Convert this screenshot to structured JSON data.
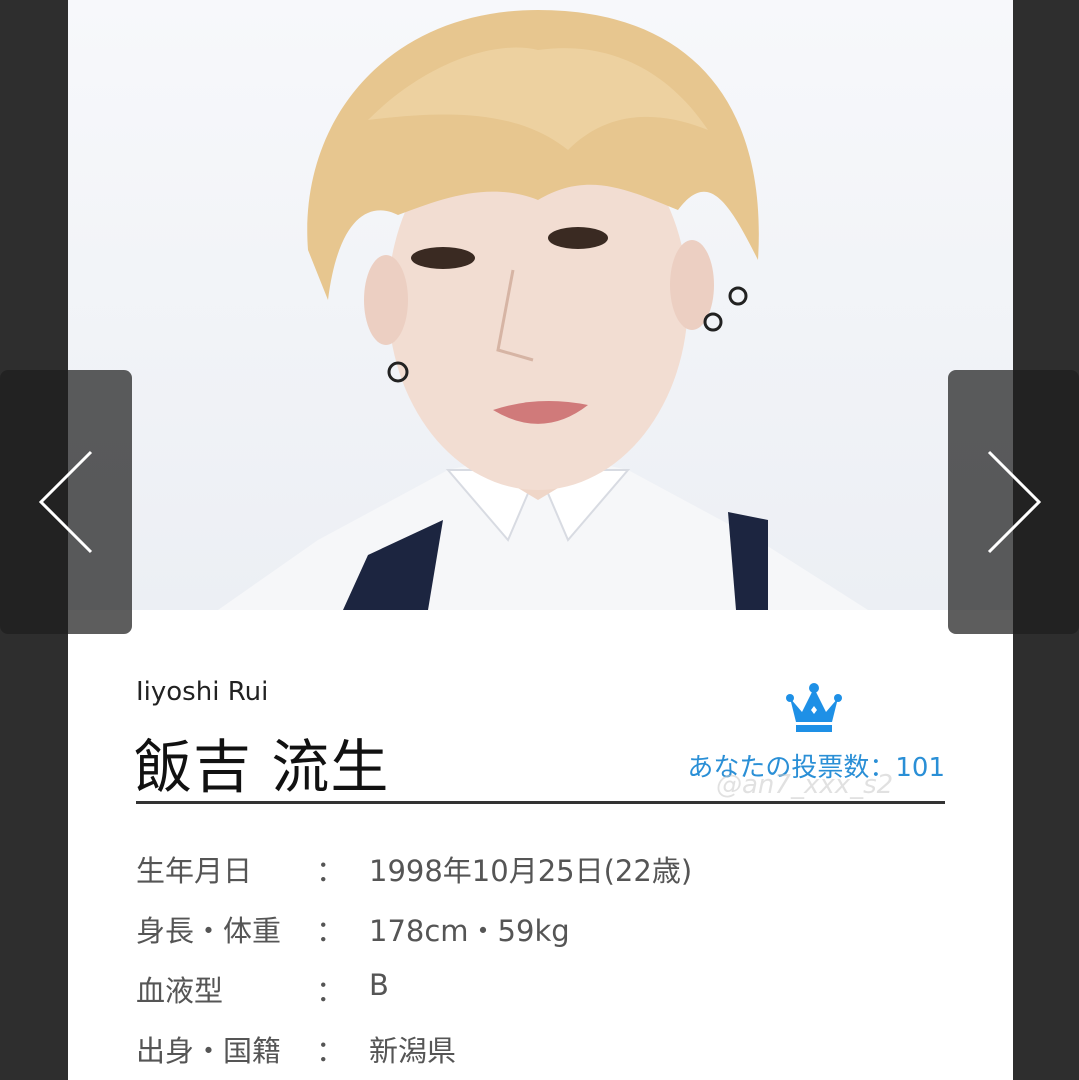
{
  "profile": {
    "name_roman": "Iiyoshi Rui",
    "name_kanji": "飯吉 流生",
    "votes_label": "あなたの投票数：101",
    "watermark": "@an7_xxx_s2",
    "separator": "：",
    "rows": [
      {
        "label": "生年月日",
        "value": "1998年10月25日(22歳)"
      },
      {
        "label": "身長・体重",
        "value": "178cm・59kg"
      },
      {
        "label": "血液型",
        "value": "B"
      },
      {
        "label": "出身・国籍",
        "value": "新潟県"
      }
    ]
  },
  "colors": {
    "accent": "#2a8fd6",
    "crown": "#1e90e6",
    "background": "#2e2e2e"
  },
  "icons": {
    "prev": "chevron-left-icon",
    "next": "chevron-right-icon",
    "crown": "crown-icon"
  }
}
